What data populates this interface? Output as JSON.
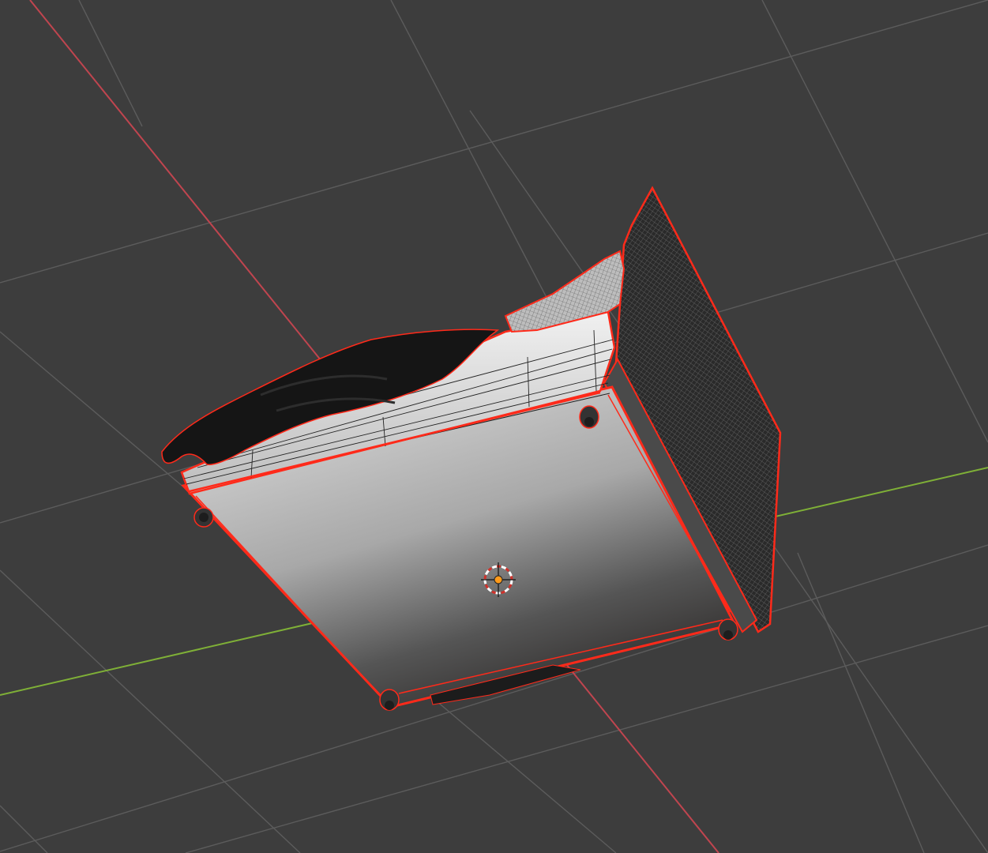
{
  "viewport": {
    "name": "3D Viewport",
    "background": "#3d3d3d",
    "grid_color": "#5a5a5a",
    "x_axis_color": "#c0454f",
    "y_axis_color": "#7fb037",
    "selection_outline_color": "#ff2a1a"
  },
  "scene": {
    "selected_object": "bed",
    "parts": [
      "bed-frame",
      "mattress",
      "blanket",
      "pillow",
      "headboard",
      "legs"
    ],
    "leg_count": 4
  },
  "overlays": {
    "origin_cursor_icon": "3d-cursor-icon"
  }
}
